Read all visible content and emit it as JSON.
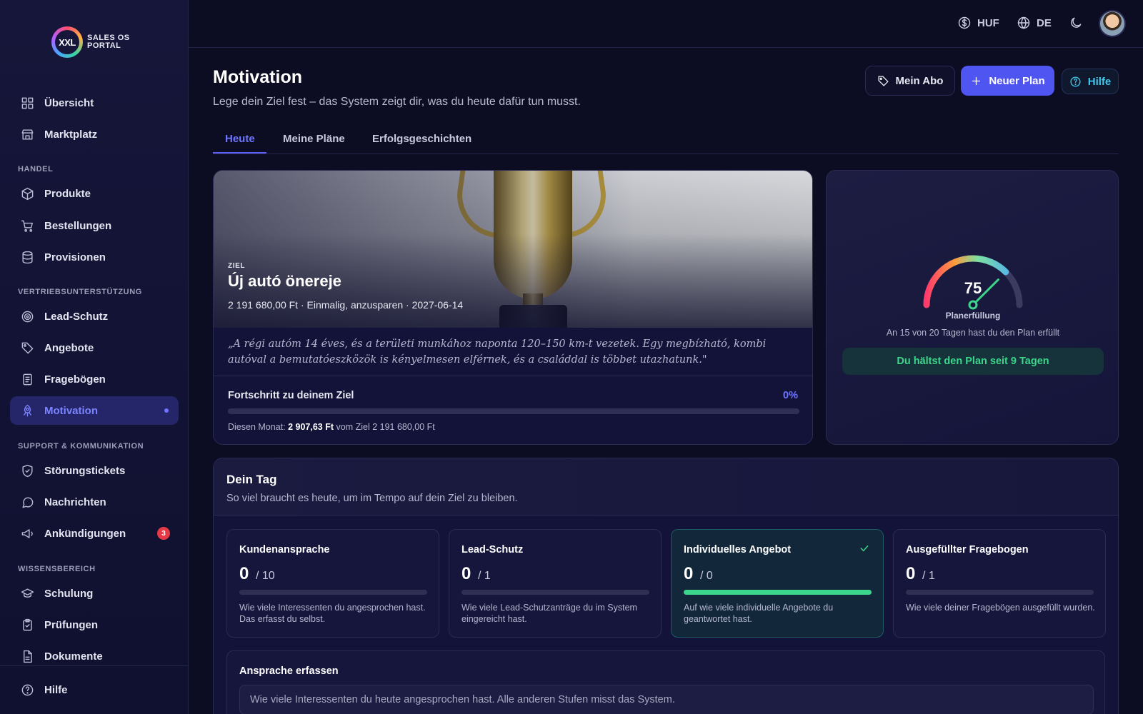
{
  "logo": {
    "mark": "XXL",
    "text": "SALES OS PORTAL"
  },
  "sidebar": {
    "items": [
      {
        "label": "Übersicht"
      },
      {
        "label": "Marktplatz"
      },
      {
        "label": "Produkte"
      },
      {
        "label": "Bestellungen"
      },
      {
        "label": "Provisionen"
      },
      {
        "label": "Lead-Schutz"
      },
      {
        "label": "Angebote"
      },
      {
        "label": "Fragebögen"
      },
      {
        "label": "Motivation"
      },
      {
        "label": "Störungstickets"
      },
      {
        "label": "Nachrichten"
      },
      {
        "label": "Ankündigungen",
        "badge": "3"
      },
      {
        "label": "Schulung"
      },
      {
        "label": "Prüfungen"
      },
      {
        "label": "Dokumente"
      },
      {
        "label": "Hilfe"
      }
    ],
    "sections": [
      "HANDEL",
      "VERTRIEBSUNTERSTÜTZUNG",
      "SUPPORT & KOMMUNIKATION",
      "WISSENSBEREICH"
    ]
  },
  "topbar": {
    "currency": "HUF",
    "language": "DE"
  },
  "header": {
    "title": "Motivation",
    "subtitle": "Lege dein Ziel fest – das System zeigt dir, was du heute dafür tun musst.",
    "btn_abo": "Mein Abo",
    "btn_plan": "Neuer Plan",
    "btn_help": "Hilfe"
  },
  "tabs": [
    {
      "label": "Heute"
    },
    {
      "label": "Meine Pläne"
    },
    {
      "label": "Erfolgsgeschichten"
    }
  ],
  "goal": {
    "label": "ZIEL",
    "title": "Új autó önereje",
    "meta": "2 191 680,00 Ft · Einmalig, anzusparen · 2027-06-14",
    "quote": "„A régi autóm 14 éves, és a területi munkához naponta 120–150 km-t vezetek. Egy megbízható, kombi autóval a bemutatóeszközök is kényelmesen elférnek, és a családdal is többet utazhatunk.\"",
    "progress_label": "Fortschritt zu deinem Ziel",
    "progress_pct": "0%",
    "progress_fraction": 0,
    "month_prefix": "Diesen Monat: ",
    "month_amount": "2 907,63 Ft",
    "month_suffix": " vom Ziel 2 191 680,00 Ft"
  },
  "gauge": {
    "value": "75",
    "fraction": 0.75,
    "label": "Planerfüllung",
    "sub": "An 15 von 20 Tagen hast du den Plan erfüllt",
    "streak": "Du hältst den Plan seit 9 Tagen"
  },
  "day": {
    "title": "Dein Tag",
    "subtitle": "So viel braucht es heute, um im Tempo auf dein Ziel zu bleiben.",
    "metrics": [
      {
        "title": "Kundenansprache",
        "value": "0",
        "total": "/ 10",
        "fraction": 0,
        "desc": "Wie viele Interessenten du angesprochen hast. Das erfasst du selbst."
      },
      {
        "title": "Lead-Schutz",
        "value": "0",
        "total": "/ 1",
        "fraction": 0,
        "desc": "Wie viele Lead-Schutzanträge du im System eingereicht hast."
      },
      {
        "title": "Individuelles Angebot",
        "value": "0",
        "total": "/ 0",
        "fraction": 1,
        "desc": "Auf wie viele individuelle Angebote du geantwortet hast."
      },
      {
        "title": "Ausgefüllter Fragebogen",
        "value": "0",
        "total": "/ 1",
        "fraction": 0,
        "desc": "Wie viele deiner Fragebögen ausgefüllt wurden."
      }
    ],
    "capture_title": "Ansprache erfassen",
    "capture_placeholder": "Wie viele Interessenten du heute angesprochen hast. Alle anderen Stufen misst das System."
  }
}
